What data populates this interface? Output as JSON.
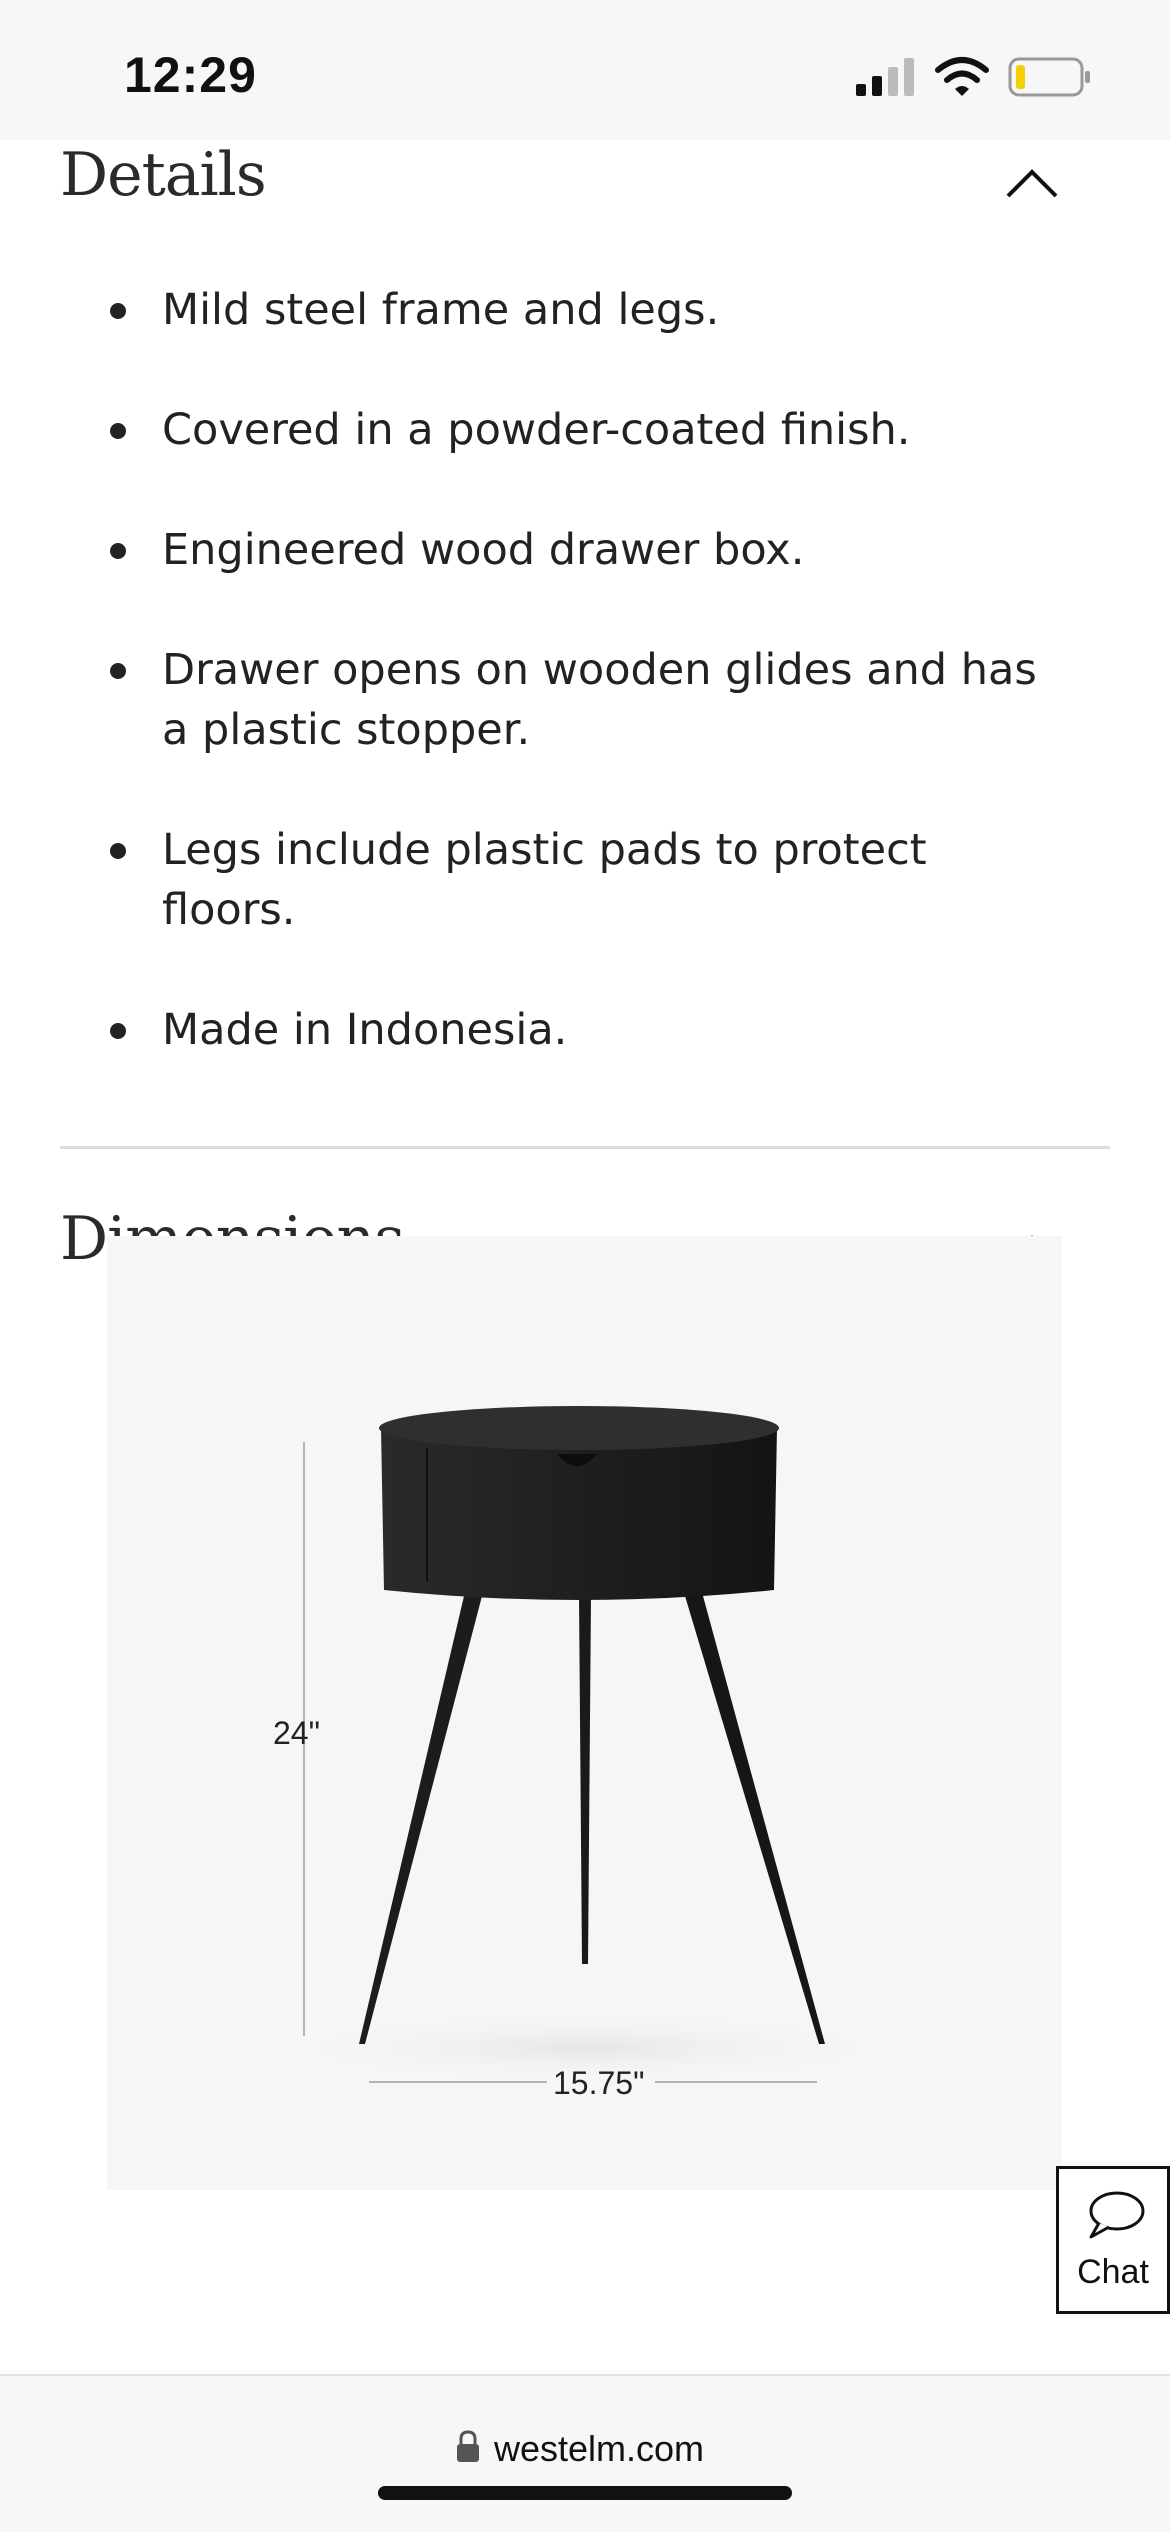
{
  "status_bar": {
    "time": "12:29"
  },
  "details": {
    "title": "Details",
    "items": [
      "Mild steel frame and legs.",
      "Covered in a powder-coated finish.",
      "Engineered wood drawer box.",
      "Drawer opens on wooden glides and has a plastic stopper.",
      "Legs include plastic pads to protect floors.",
      "Made in Indonesia."
    ]
  },
  "dimensions": {
    "title": "Dimensions",
    "height_label": "24\"",
    "width_label": "15.75\""
  },
  "chat": {
    "label": "Chat"
  },
  "url_bar": {
    "domain": "westelm.com"
  },
  "icons": {
    "signal": "signal-icon",
    "wifi": "wifi-icon",
    "battery": "battery-icon",
    "collapse": "chevron-up-icon",
    "chat": "chat-bubble-icon",
    "lock": "lock-icon"
  },
  "colors": {
    "battery_level": "#f5d000",
    "text": "#222222",
    "divider": "#dcdcdc",
    "product": "#1e1e1e"
  }
}
